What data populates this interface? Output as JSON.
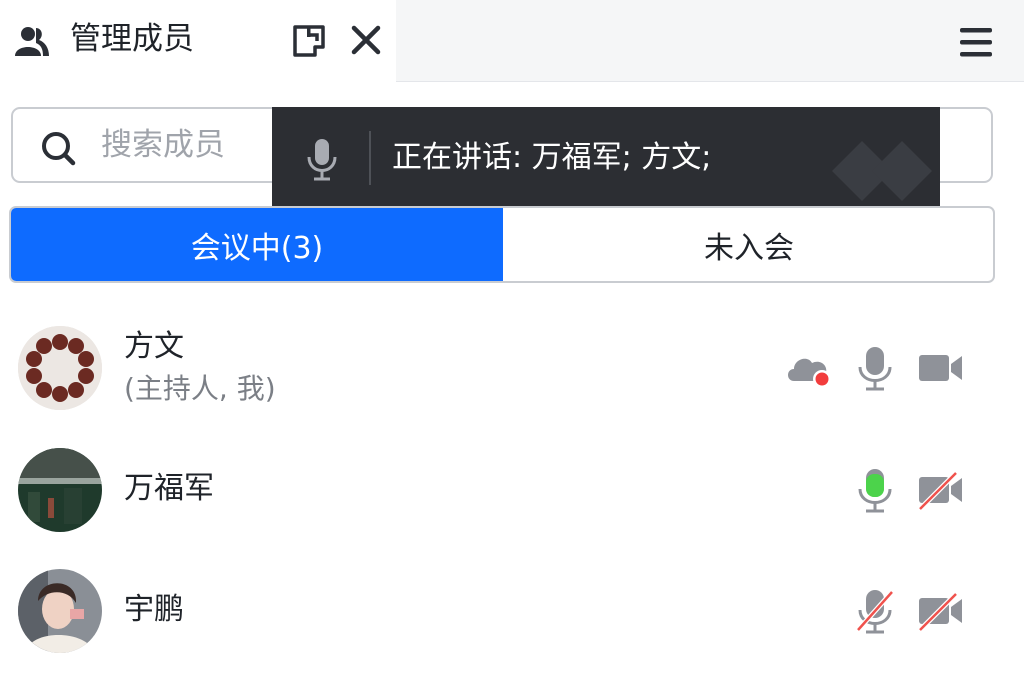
{
  "header": {
    "tab_title": "管理成员",
    "tab_icon": "members-icon",
    "popout_icon": "popout-window-icon",
    "close_icon": "close-icon",
    "menu_icon": "menu-icon"
  },
  "search": {
    "placeholder": "搜索成员",
    "icon": "search-icon"
  },
  "speaking": {
    "icon": "microphone-icon",
    "text": "正在讲话:  万福军; 方文;"
  },
  "tabs": [
    {
      "label": "会议中(3)",
      "active": true
    },
    {
      "label": "未入会",
      "active": false
    }
  ],
  "members": [
    {
      "name": "方文",
      "role": "(主持人, 我)",
      "recording": true,
      "mic": "on",
      "camera": "on"
    },
    {
      "name": "万福军",
      "role": "",
      "recording": false,
      "mic": "speaking",
      "camera": "off"
    },
    {
      "name": "宇鹏",
      "role": "",
      "recording": false,
      "mic": "muted",
      "camera": "off"
    }
  ],
  "colors": {
    "accent": "#0e6bff",
    "speaking_mic": "#4cd34b",
    "muted_slash": "#f0524d",
    "recording_dot": "#f23d3d",
    "icon_gray": "#8f9299"
  }
}
